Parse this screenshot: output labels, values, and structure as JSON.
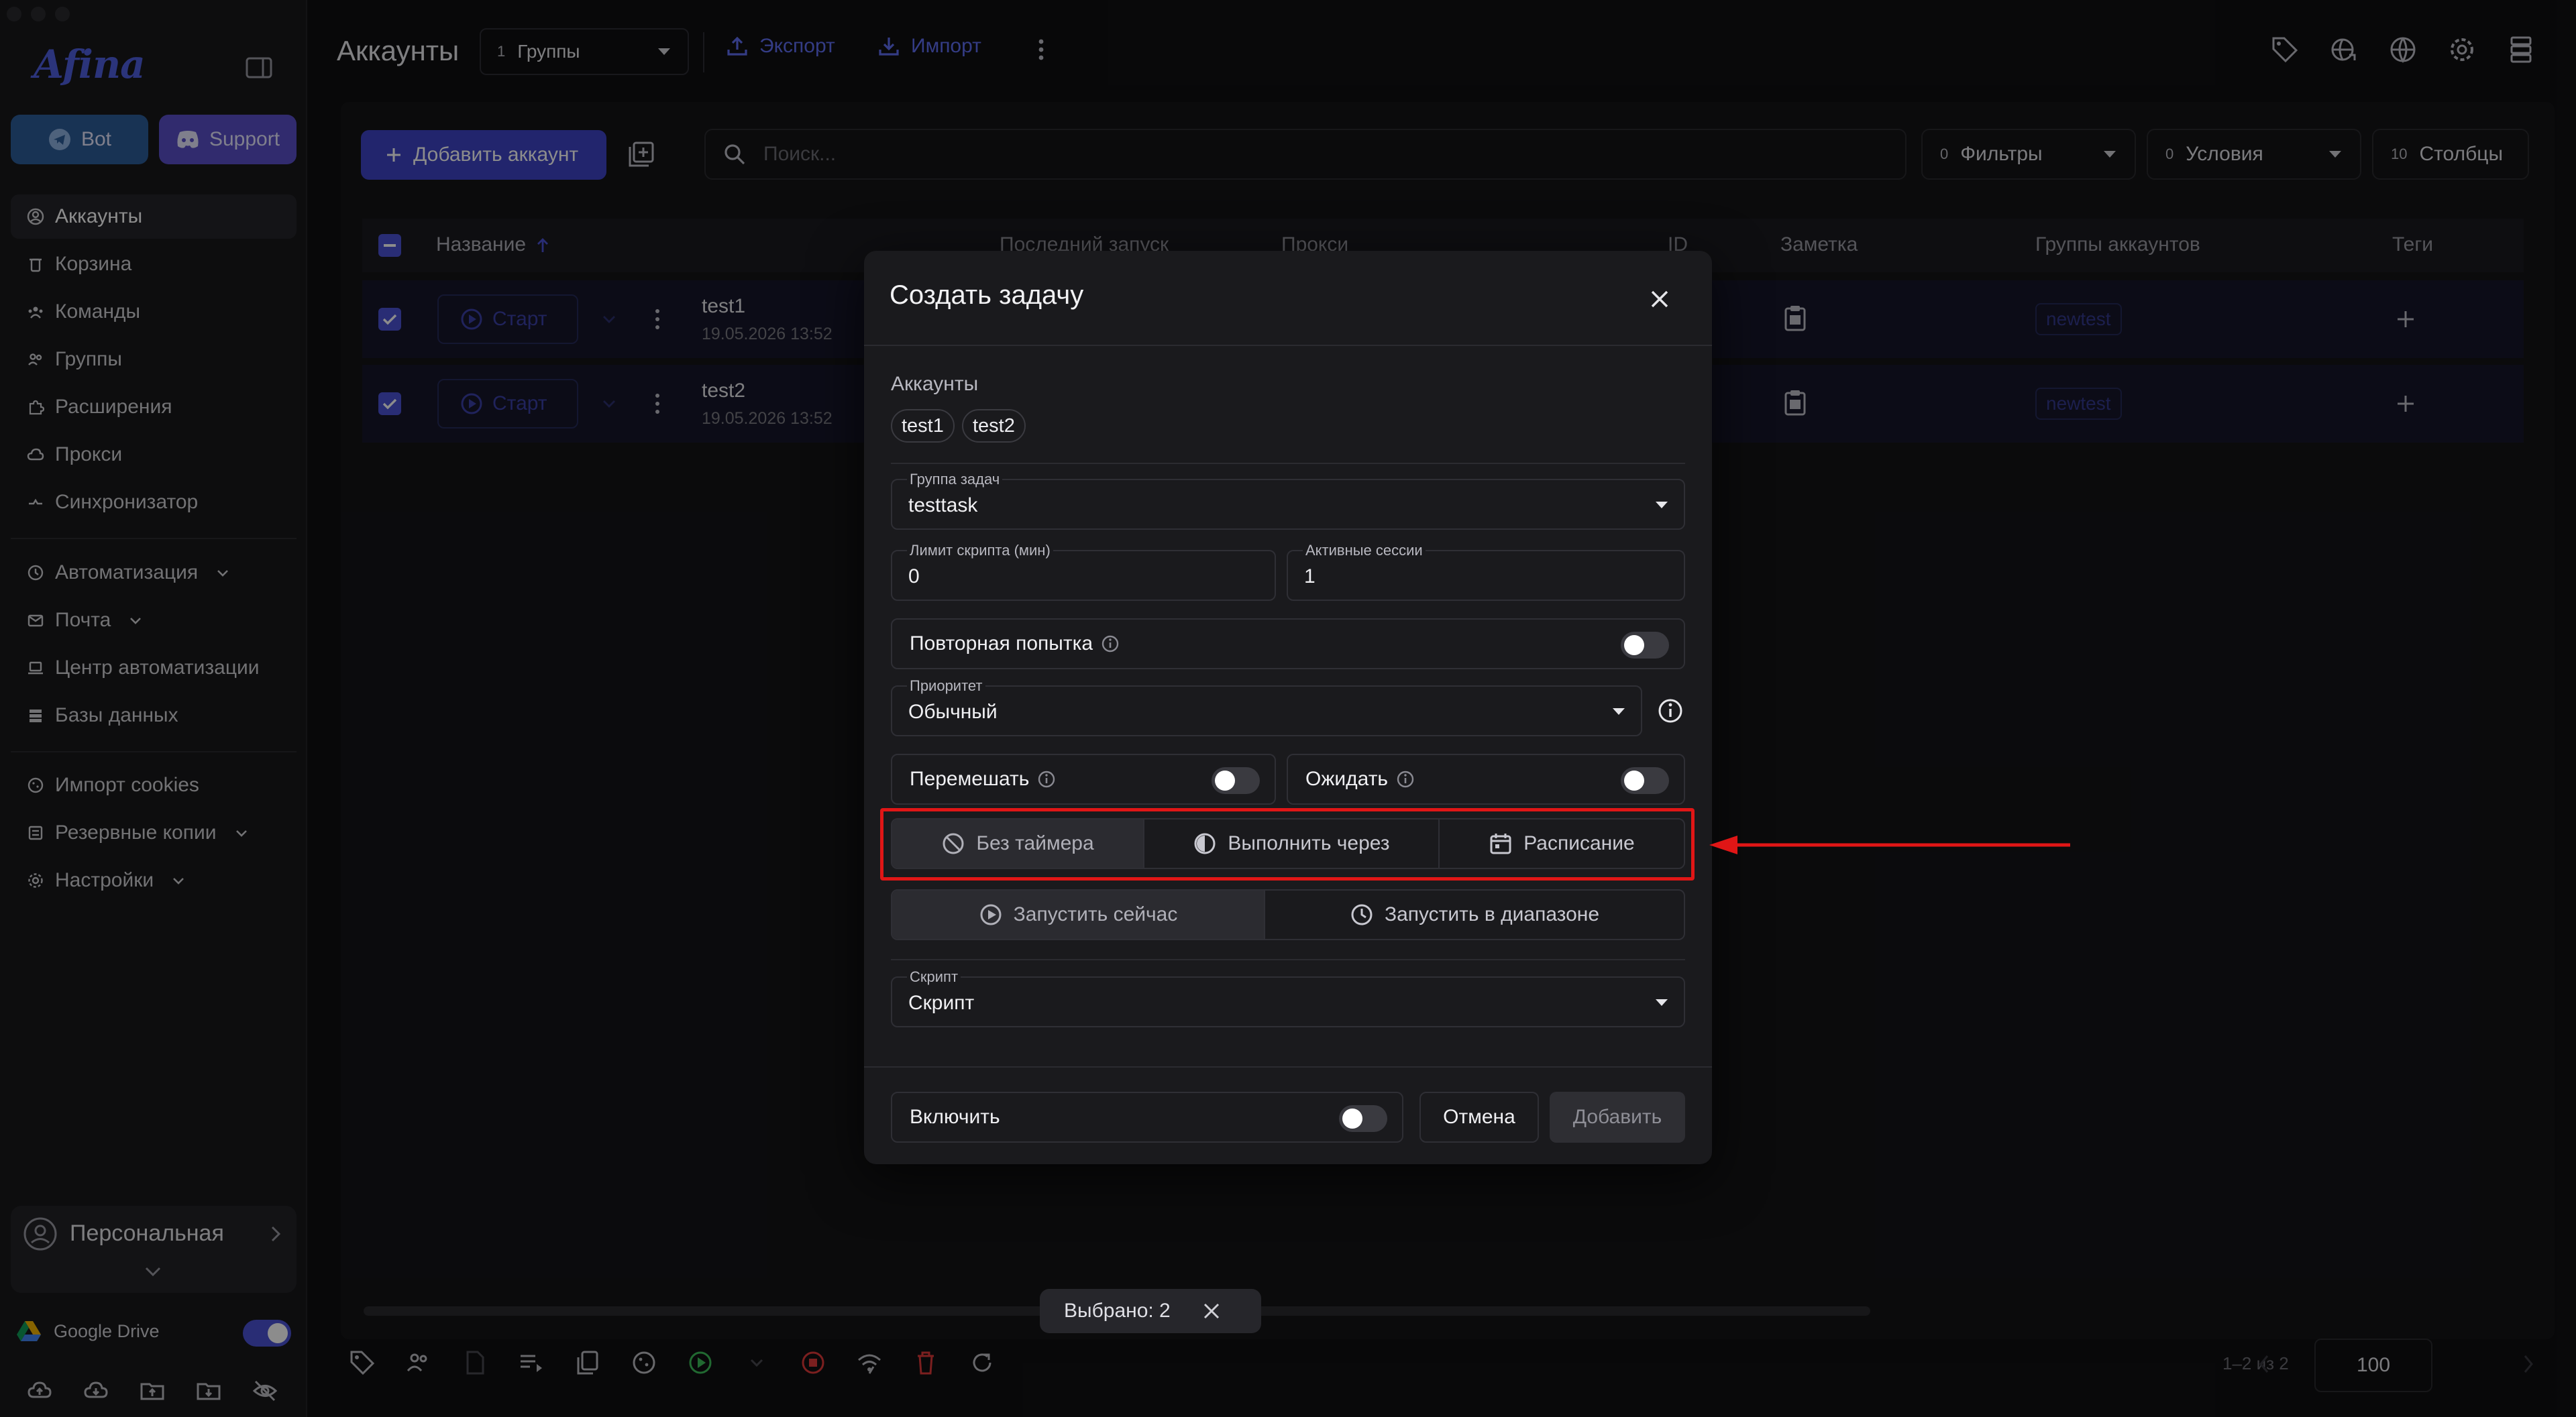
{
  "sidebar": {
    "logo": "Afina",
    "bot_label": "Bot",
    "support_label": "Support",
    "nav": [
      {
        "label": "Аккаунты",
        "icon": "user-circle-icon"
      },
      {
        "label": "Корзина",
        "icon": "trash-icon"
      },
      {
        "label": "Команды",
        "icon": "team-icon"
      },
      {
        "label": "Группы",
        "icon": "group-icon"
      },
      {
        "label": "Расширения",
        "icon": "puzzle-icon"
      },
      {
        "label": "Прокси",
        "icon": "cloud-icon"
      },
      {
        "label": "Синхронизатор",
        "icon": "sync-icon"
      },
      {
        "label": "Автоматизация",
        "icon": "automation-icon"
      },
      {
        "label": "Почта",
        "icon": "mail-icon"
      },
      {
        "label": "Центр автоматизации",
        "icon": "laptop-icon"
      },
      {
        "label": "Базы данных",
        "icon": "database-icon"
      },
      {
        "label": "Импорт cookies",
        "icon": "cookie-icon"
      },
      {
        "label": "Резервные копии",
        "icon": "backup-icon"
      },
      {
        "label": "Настройки",
        "icon": "gear-icon"
      }
    ],
    "profile_label": "Персональная",
    "gdrive_label": "Google Drive"
  },
  "header": {
    "title": "Аккаунты",
    "groups_count": "1",
    "groups_label": "Группы",
    "export_label": "Экспорт",
    "import_label": "Импорт"
  },
  "toolbar": {
    "add_account_label": "Добавить аккаунт",
    "search_placeholder": "Поиск...",
    "filters_count": "0",
    "filters_label": "Фильтры",
    "conditions_count": "0",
    "conditions_label": "Условия",
    "columns_count": "10",
    "columns_label": "Столбцы"
  },
  "table": {
    "columns": [
      "Название",
      "Последний запуск",
      "Прокси",
      "ID",
      "Заметка",
      "Группы аккаунтов",
      "Теги"
    ],
    "rows": [
      {
        "start_label": "Старт",
        "name": "test1",
        "date": "19.05.2026 13:52",
        "group": "newtest"
      },
      {
        "start_label": "Старт",
        "name": "test2",
        "date": "19.05.2026 13:52",
        "group": "newtest"
      }
    ]
  },
  "selection": {
    "label": "Выбрано: 2"
  },
  "pager": {
    "range_text": "1–2 из 2",
    "page_size": "100"
  },
  "modal": {
    "title": "Создать задачу",
    "accounts_label": "Аккаунты",
    "accounts": [
      "test1",
      "test2"
    ],
    "task_group_label": "Группа задач",
    "task_group_value": "testtask",
    "script_limit_label": "Лимит скрипта (мин)",
    "script_limit_value": "0",
    "active_sessions_label": "Активные сессии",
    "active_sessions_value": "1",
    "retry_label": "Повторная попытка",
    "priority_label": "Приоритет",
    "priority_value": "Обычный",
    "shuffle_label": "Перемешать",
    "wait_label": "Ожидать",
    "timer_options": [
      "Без таймера",
      "Выполнить через",
      "Расписание"
    ],
    "timer_selected": "Без таймера",
    "run_options": [
      "Запустить сейчас",
      "Запустить в диапазоне"
    ],
    "run_selected": "Запустить сейчас",
    "script_label": "Скрипт",
    "script_value": "Скрипт",
    "enable_label": "Включить",
    "cancel_label": "Отмена",
    "add_label": "Добавить"
  },
  "colors": {
    "accent": "#4b52d6",
    "highlight": "#e01616",
    "background": "#101012"
  }
}
